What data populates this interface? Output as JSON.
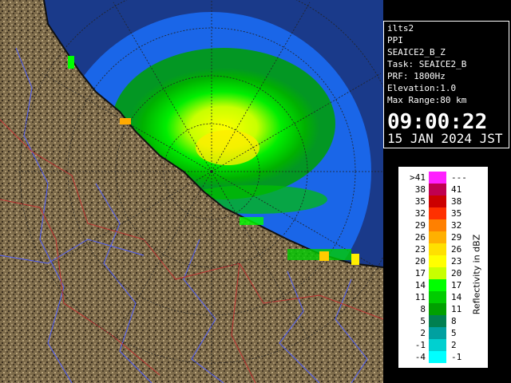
{
  "app": {
    "site": "ilts2",
    "scan_type": "PPI",
    "product": "SEAICE2_B_Z",
    "task": "Task: SEAICE2_B",
    "prf": "PRF: 1800Hz",
    "elevation": "Elevation:1.0",
    "max_range": "Max Range:80 km",
    "time": "09:00:22",
    "date": "15 JAN 2024 JST"
  },
  "legend": {
    "title": "Reflectivity in dBZ",
    "rows": [
      {
        "lo": ">41",
        "hi": "---",
        "color": "#ff20ff"
      },
      {
        "lo": "38",
        "hi": "41",
        "color": "#c00050"
      },
      {
        "lo": "35",
        "hi": "38",
        "color": "#cc0000"
      },
      {
        "lo": "32",
        "hi": "35",
        "color": "#ff3000"
      },
      {
        "lo": "29",
        "hi": "32",
        "color": "#ff8000"
      },
      {
        "lo": "26",
        "hi": "29",
        "color": "#ffb000"
      },
      {
        "lo": "23",
        "hi": "26",
        "color": "#ffe000"
      },
      {
        "lo": "20",
        "hi": "23",
        "color": "#ffff00"
      },
      {
        "lo": "17",
        "hi": "20",
        "color": "#c8ff00"
      },
      {
        "lo": "14",
        "hi": "17",
        "color": "#00ff00"
      },
      {
        "lo": "11",
        "hi": "14",
        "color": "#00cc00"
      },
      {
        "lo": "8",
        "hi": "11",
        "color": "#00a000"
      },
      {
        "lo": "5",
        "hi": "8",
        "color": "#008050"
      },
      {
        "lo": "2",
        "hi": "5",
        "color": "#00a0a0"
      },
      {
        "lo": "-1",
        "hi": "2",
        "color": "#00d0d0"
      },
      {
        "lo": "-4",
        "hi": "-1",
        "color": "#00ffff"
      }
    ]
  },
  "colors": {
    "sea": "#1a3a8a",
    "radar_bg": "#1a66e8",
    "land": "#7a6a4a",
    "coast": "#101010",
    "rivers": "#5060ff",
    "borders": "#c03030"
  }
}
